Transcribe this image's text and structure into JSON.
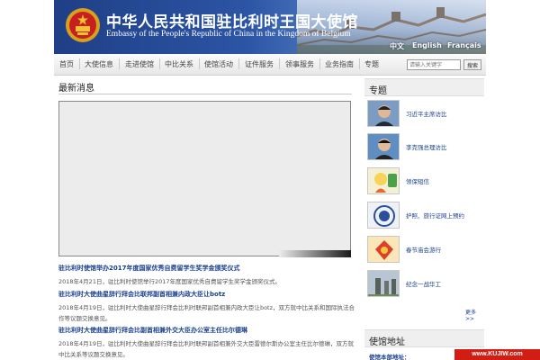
{
  "header": {
    "title_cn": "中华人民共和国驻比利时王国大使馆",
    "title_en": "Embassy of the People's Republic of China in the Kingdom of Belgium",
    "languages": [
      "中文",
      "English",
      "Français"
    ]
  },
  "nav": {
    "items": [
      "首页",
      "大使信息",
      "走进使馆",
      "中比关系",
      "使馆活动",
      "证件服务",
      "领事服务",
      "业务指南",
      "专题"
    ],
    "search_placeholder": "请输入关键字",
    "search_button": "搜索"
  },
  "main": {
    "section_title": "最新消息",
    "news": [
      {
        "title": "驻比利时使馆举办2017年度国家优秀自费留学生奖学金颁奖仪式",
        "body": "2018年4月21日，驻比利时使馆举行2017年度国家优秀自费留学生奖学金颁奖仪式。"
      },
      {
        "title": "驻比利时大使曲星辞行拜会比联邦副首相兼内政大臣让botz",
        "body": "2018年4月19日，驻比利时大使曲星辞行拜会比利时联邦副首相兼内政大臣让botz，双方就中比关系和国际执法合作等议题交换意见。"
      },
      {
        "title": "驻比利时大使曲星辞行拜会比副首相兼外交大臣办公室主任比尔德琳",
        "body": "2018年4月19日，驻比利时大使曲星辞行拜会比利时联邦副首相兼外交大臣雷德尔斯办公室主任比尔德琳，双方就中比关系等议题交换意见。"
      }
    ]
  },
  "sidebar": {
    "topics_header": "专题",
    "topics": [
      {
        "label": "习近平主席访比",
        "icon": "portrait-thumb"
      },
      {
        "label": "李克强总理访比",
        "icon": "portrait-thumb"
      },
      {
        "label": "领保短信",
        "icon": "cartoon-thumb"
      },
      {
        "label": "护照、旅行证网上预约",
        "icon": "seal-thumb"
      },
      {
        "label": "春节庙会游行",
        "icon": "festival-thumb"
      },
      {
        "label": "纪念一战华工",
        "icon": "monument-thumb"
      }
    ],
    "more": "更多>>",
    "address_header": "使馆地址",
    "address_label": "使馆本部地址："
  },
  "watermark": "www.KUJIW.com",
  "colors": {
    "banner_blue": "#2c55a5",
    "link_blue": "#1a3f8f",
    "watermark_red": "#d11d14"
  }
}
